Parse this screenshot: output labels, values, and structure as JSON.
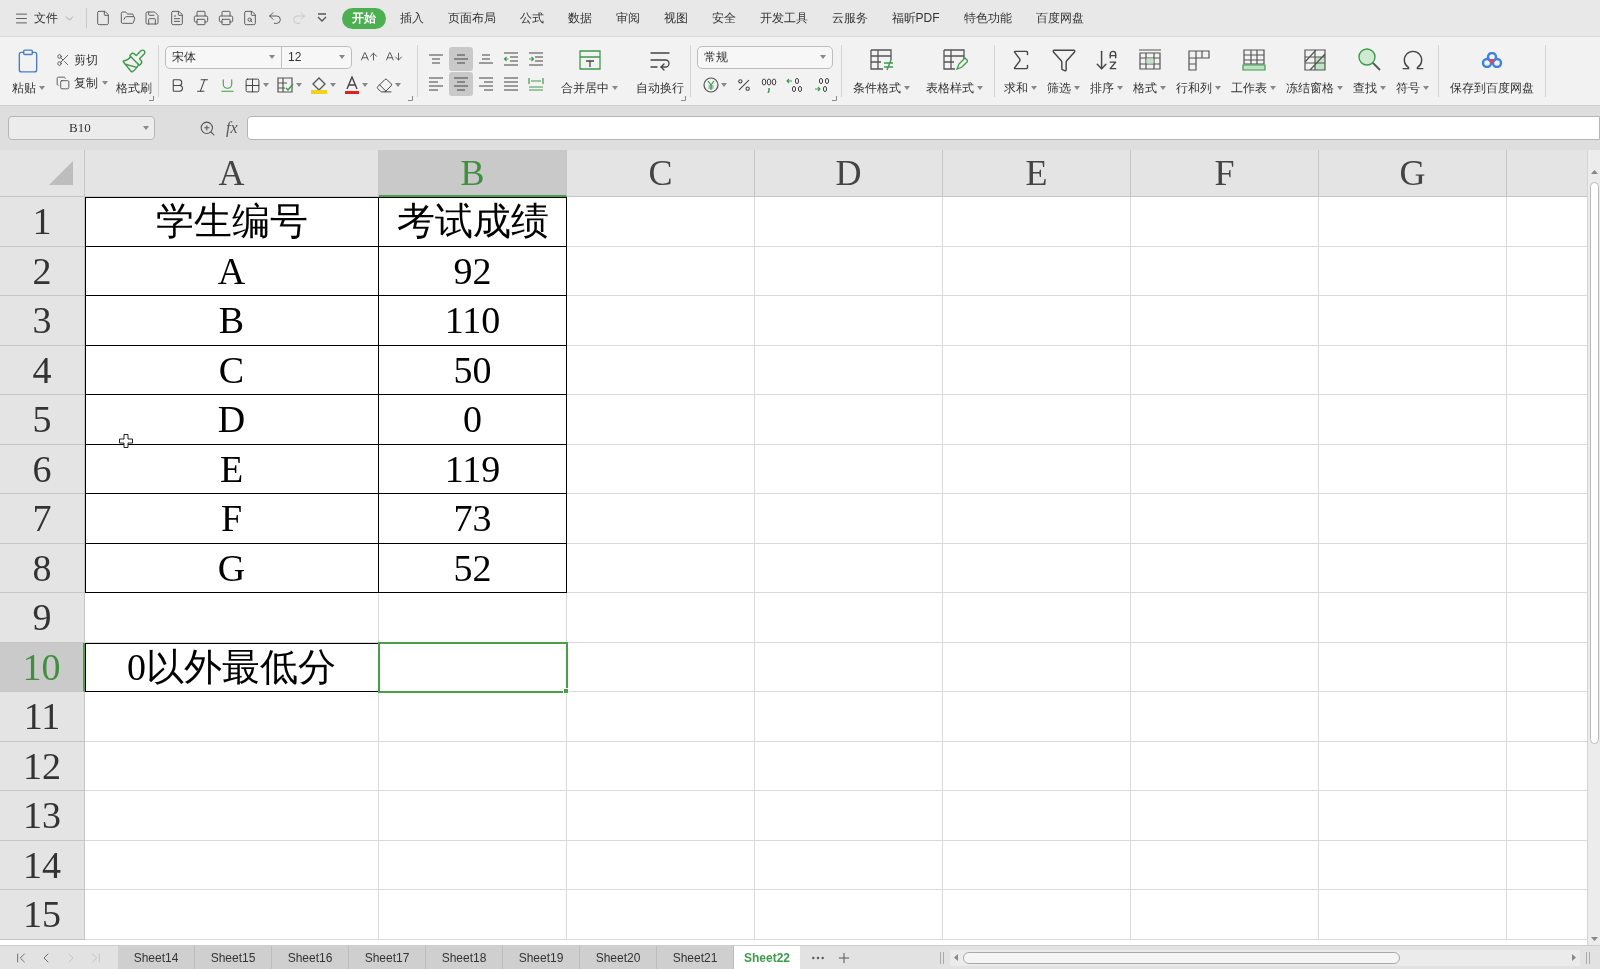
{
  "menu_bar": {
    "file_menu": "文件",
    "quick_access": [
      {
        "kind": "new",
        "disabled": false
      },
      {
        "kind": "open",
        "disabled": false
      },
      {
        "kind": "save",
        "disabled": false
      },
      {
        "kind": "pdf",
        "disabled": false
      },
      {
        "kind": "print",
        "disabled": false
      },
      {
        "kind": "print_setup",
        "disabled": false
      },
      {
        "kind": "preview",
        "disabled": false
      },
      {
        "kind": "undo",
        "disabled": false
      },
      {
        "kind": "redo",
        "disabled": true
      },
      {
        "kind": "customize",
        "disabled": false
      }
    ],
    "tabs": [
      {
        "label": "开始",
        "selected": true
      },
      {
        "label": "插入",
        "selected": false
      },
      {
        "label": "页面布局",
        "selected": false
      },
      {
        "label": "公式",
        "selected": false
      },
      {
        "label": "数据",
        "selected": false
      },
      {
        "label": "审阅",
        "selected": false
      },
      {
        "label": "视图",
        "selected": false
      },
      {
        "label": "安全",
        "selected": false
      },
      {
        "label": "开发工具",
        "selected": false
      },
      {
        "label": "云服务",
        "selected": false
      },
      {
        "label": "福昕PDF",
        "selected": false
      },
      {
        "label": "特色功能",
        "selected": false
      },
      {
        "label": "百度网盘",
        "selected": false
      }
    ]
  },
  "ribbon": {
    "clipboard": {
      "paste": "粘贴",
      "cut": "剪切",
      "copy": "复制",
      "format_painter": "格式刷"
    },
    "font": {
      "name": "宋体",
      "size": "12"
    },
    "alignment": {
      "vertical_align": [
        {
          "kind": "top",
          "selected": false
        },
        {
          "kind": "middle",
          "selected": true
        },
        {
          "kind": "bottom",
          "selected": false
        }
      ],
      "horizontal_align": [
        {
          "kind": "left",
          "selected": false
        },
        {
          "kind": "center",
          "selected": true
        },
        {
          "kind": "right",
          "selected": false
        },
        {
          "kind": "justify",
          "selected": false
        },
        {
          "kind": "distributed",
          "selected": false
        }
      ],
      "merge_center": "合并居中",
      "wrap_text": "自动换行"
    },
    "number": {
      "format": "常规"
    },
    "styles": [
      {
        "kind": "conditional",
        "label": "条件格式"
      },
      {
        "kind": "table_style",
        "label": "表格样式"
      }
    ],
    "editing": [
      {
        "kind": "sum",
        "label": "求和"
      },
      {
        "kind": "filter",
        "label": "筛选"
      },
      {
        "kind": "sort",
        "label": "排序"
      },
      {
        "kind": "format",
        "label": "格式"
      },
      {
        "kind": "rows_cols",
        "label": "行和列"
      },
      {
        "kind": "worksheet",
        "label": "工作表"
      },
      {
        "kind": "freeze",
        "label": "冻结窗格"
      },
      {
        "kind": "find",
        "label": "查找"
      },
      {
        "kind": "symbol",
        "label": "符号"
      }
    ],
    "cloud_save": "保存到百度网盘"
  },
  "formula_bar": {
    "name_box": "B10",
    "fx": "fx"
  },
  "sheet": {
    "columns": [
      {
        "label": "A",
        "selected": false
      },
      {
        "label": "B",
        "selected": true
      },
      {
        "label": "C",
        "selected": false
      },
      {
        "label": "D",
        "selected": false
      },
      {
        "label": "E",
        "selected": false
      },
      {
        "label": "F",
        "selected": false
      },
      {
        "label": "G",
        "selected": false
      }
    ],
    "rows": [
      {
        "label": "1",
        "selected": false,
        "cells": [
          {
            "text": "学生编号",
            "bordered": true,
            "selected": false
          },
          {
            "text": "考试成绩",
            "bordered": true,
            "selected": false
          }
        ]
      },
      {
        "label": "2",
        "selected": false,
        "cells": [
          {
            "text": "A",
            "bordered": true,
            "selected": false
          },
          {
            "text": "92",
            "bordered": true,
            "selected": false
          }
        ]
      },
      {
        "label": "3",
        "selected": false,
        "cells": [
          {
            "text": "B",
            "bordered": true,
            "selected": false
          },
          {
            "text": "110",
            "bordered": true,
            "selected": false
          }
        ]
      },
      {
        "label": "4",
        "selected": false,
        "cells": [
          {
            "text": "C",
            "bordered": true,
            "selected": false
          },
          {
            "text": "50",
            "bordered": true,
            "selected": false
          }
        ]
      },
      {
        "label": "5",
        "selected": false,
        "cells": [
          {
            "text": "D",
            "bordered": true,
            "selected": false
          },
          {
            "text": "0",
            "bordered": true,
            "selected": false
          }
        ]
      },
      {
        "label": "6",
        "selected": false,
        "cells": [
          {
            "text": "E",
            "bordered": true,
            "selected": false
          },
          {
            "text": "119",
            "bordered": true,
            "selected": false
          }
        ]
      },
      {
        "label": "7",
        "selected": false,
        "cells": [
          {
            "text": "F",
            "bordered": true,
            "selected": false
          },
          {
            "text": "73",
            "bordered": true,
            "selected": false
          }
        ]
      },
      {
        "label": "8",
        "selected": false,
        "cells": [
          {
            "text": "G",
            "bordered": true,
            "selected": false
          },
          {
            "text": "52",
            "bordered": true,
            "selected": false
          }
        ]
      },
      {
        "label": "9",
        "selected": false
      },
      {
        "label": "10",
        "selected": true,
        "cells": [
          {
            "text": "0以外最低分",
            "bordered": true,
            "selected": false
          },
          {
            "bordered": false,
            "selected": true
          }
        ]
      },
      {
        "label": "11",
        "selected": false
      },
      {
        "label": "12",
        "selected": false
      },
      {
        "label": "13",
        "selected": false
      },
      {
        "label": "14",
        "selected": false
      },
      {
        "label": "15",
        "selected": false
      }
    ]
  },
  "sheet_tabs": [
    {
      "label": "Sheet14",
      "selected": false
    },
    {
      "label": "Sheet15",
      "selected": false
    },
    {
      "label": "Sheet16",
      "selected": false
    },
    {
      "label": "Sheet17",
      "selected": false
    },
    {
      "label": "Sheet18",
      "selected": false
    },
    {
      "label": "Sheet19",
      "selected": false
    },
    {
      "label": "Sheet20",
      "selected": false
    },
    {
      "label": "Sheet21",
      "selected": false
    },
    {
      "label": "Sheet22",
      "selected": true
    }
  ]
}
